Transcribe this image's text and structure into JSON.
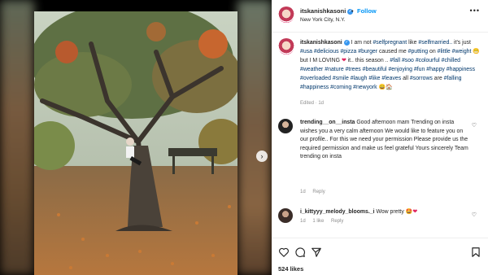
{
  "post": {
    "username": "itskanishkasoni",
    "follow_label": "Follow",
    "dot": "•",
    "location": "New York City, N.Y.",
    "caption_start": "I am not #selfpregnant like #selfmarried.. it's just #usa #delicious #pizza #burger caused me #putting on #little #weight",
    "caption_mid": "but I M LOVING",
    "caption_end": "it.. this season .. #fall #soo #colourful #chilled #weather #nature #trees #beautiful #enjoying #fun #happy #happiness #overloaded #smile #laugh #like #leaves all #sorrows are #falling #happiness #coming #newyork",
    "caption_meta": "Edited · 1d",
    "likes": "524 likes"
  },
  "comments": [
    {
      "username": "trending__on__insta",
      "text": "Good afternoon mam Trending on insta wishes you a very calm afternoon We would like to feature you on our profile.. For this we need your permission Please provide us the required permission and make us feel grateful Yours sincerely Team trending on insta",
      "time": "1d",
      "reply": "Reply"
    },
    {
      "username": "i_kittyyy_melody_blooms._i",
      "text": "Wow pretty",
      "time": "1d",
      "likes": "1 like",
      "reply": "Reply"
    }
  ],
  "icons": {
    "verified": "verified-badge-icon",
    "more": "more-options-icon",
    "next": "chevron-right-icon",
    "like": "heart-icon",
    "comment": "comment-icon",
    "share": "share-icon",
    "save": "bookmark-icon"
  },
  "colors": {
    "link": "#0095f6",
    "hashtag": "#00376b",
    "verified": "#3897f0"
  }
}
